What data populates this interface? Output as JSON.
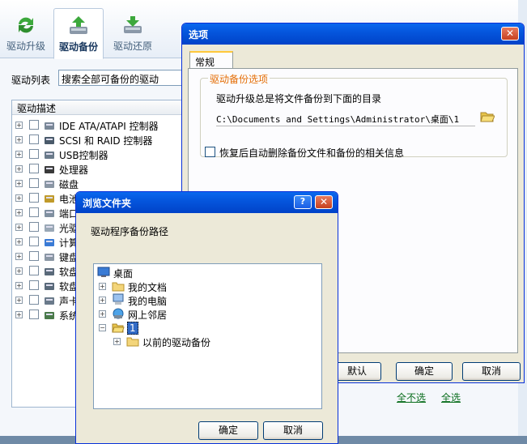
{
  "app": {
    "tabs": [
      {
        "label": "驱动升级",
        "icon": "refresh-icon"
      },
      {
        "label": "驱动备份",
        "icon": "backup-icon"
      },
      {
        "label": "驱动还原",
        "icon": "restore-icon"
      }
    ],
    "list_label": "驱动列表",
    "list_select_value": "搜索全部可备份的驱动",
    "tree_header": "驱动描述",
    "tree_items": [
      {
        "label": "IDE ATA/ATAPI 控制器",
        "icon": "ide-controller-icon"
      },
      {
        "label": "SCSI 和 RAID 控制器",
        "icon": "scsi-icon"
      },
      {
        "label": "USB控制器",
        "icon": "usb-icon"
      },
      {
        "label": "处理器",
        "icon": "processor-icon"
      },
      {
        "label": "磁盘",
        "icon": "disk-icon"
      },
      {
        "label": "电池",
        "icon": "battery-icon"
      },
      {
        "label": "端口",
        "icon": "port-icon"
      },
      {
        "label": "光驱",
        "icon": "optical-drive-icon"
      },
      {
        "label": "计算",
        "icon": "computer-icon"
      },
      {
        "label": "键盘",
        "icon": "keyboard-icon"
      },
      {
        "label": "软盘",
        "icon": "floppy-icon"
      },
      {
        "label": "软盘",
        "icon": "floppy-icon"
      },
      {
        "label": "声卡",
        "icon": "sound-icon"
      },
      {
        "label": "系统",
        "icon": "system-icon"
      }
    ],
    "select_none": "全不选",
    "select_all": "全选"
  },
  "options_dialog": {
    "title": "选项",
    "close": "✕",
    "tab_general": "常规",
    "group_title": "驱动备份选项",
    "description": "驱动升级总是将文件备份到下面的目录",
    "path": "C:\\Documents and Settings\\Administrator\\桌面\\1",
    "checkbox_label": "恢复后自动删除备份文件和备份的相关信息",
    "btn_default": "默认",
    "btn_ok": "确定",
    "btn_cancel": "取消"
  },
  "browse_dialog": {
    "title": "浏览文件夹",
    "help": "?",
    "close": "✕",
    "description": "驱动程序备份路径",
    "tree": [
      {
        "label": "桌面",
        "icon": "desktop-icon"
      },
      {
        "label": "我的文档",
        "icon": "folder-icon"
      },
      {
        "label": "我的电脑",
        "icon": "my-computer-icon"
      },
      {
        "label": "网上邻居",
        "icon": "network-icon"
      },
      {
        "label": "1",
        "icon": "open-folder-icon"
      },
      {
        "label": "以前的驱动备份",
        "icon": "folder-icon"
      }
    ],
    "btn_ok": "确定",
    "btn_cancel": "取消"
  },
  "colors": {
    "xp_title": "#0556dd",
    "group_title": "#e46e06",
    "link": "#0a6e1e",
    "selection": "#316ac5"
  }
}
